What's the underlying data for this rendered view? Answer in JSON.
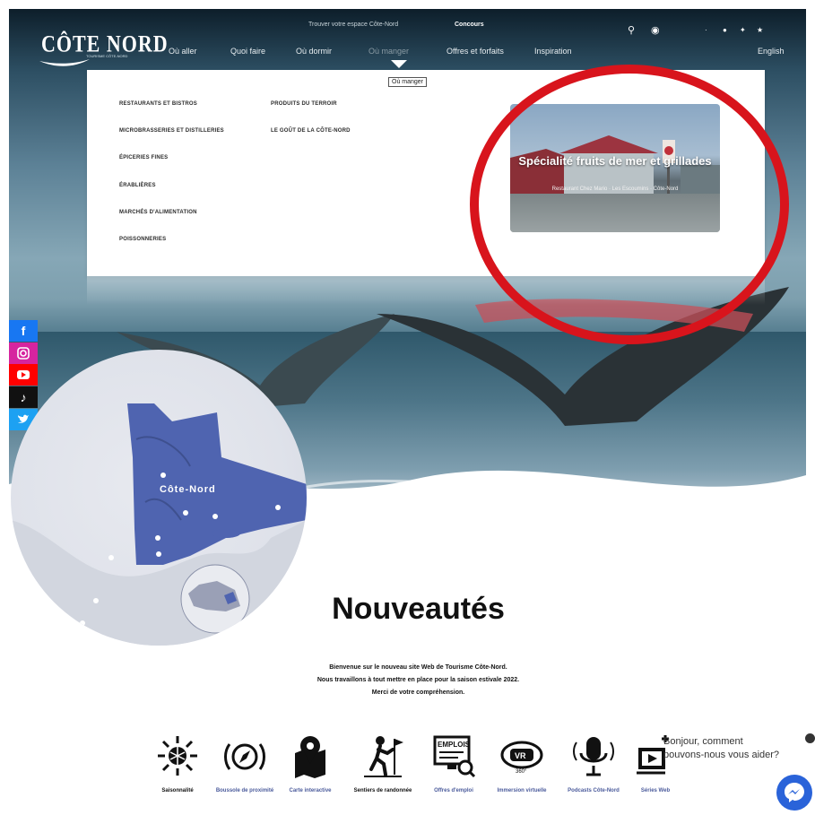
{
  "brand": {
    "logo": "CÔTE NORD",
    "logo_sub": "TOURISME CÔTE-NORD"
  },
  "top_utility": {
    "space_link": "Trouver votre espace Côte-Nord",
    "contest": "Concours"
  },
  "nav": {
    "items": [
      "Où aller",
      "Quoi faire",
      "Où dormir",
      "Où manger",
      "Offres et forfaits",
      "Inspiration"
    ],
    "language": "English",
    "active": "Où manger",
    "tooltip": "Où manger"
  },
  "dropdown": {
    "col1": [
      "RESTAURANTS ET BISTROS",
      "MICROBRASSERIES ET DISTILLERIES",
      "ÉPICERIES FINES",
      "ÉRABLIÈRES",
      "MARCHÉS D'ALIMENTATION",
      "POISSONNERIES"
    ],
    "col2": [
      "PRODUITS DU TERROIR",
      "LE GOÛT DE LA CÔTE-NORD"
    ],
    "promo": {
      "title": "Spécialité fruits de mer et grillades",
      "subtitle": "Restaurant Chez Mario · Les Escoumins · Côte-Nord"
    }
  },
  "social": [
    "facebook-icon",
    "instagram-icon",
    "youtube-icon",
    "tiktok-icon",
    "twitter-icon"
  ],
  "social_colors": [
    "#1877f2",
    "#d6249f",
    "#ff0000",
    "#111111",
    "#1da1f2"
  ],
  "map": {
    "region_label": "Côte-Nord",
    "region_color": "#4f64b0"
  },
  "news": {
    "title": "Nouveautés",
    "lines": [
      "Bienvenue sur le nouveau site Web de Tourisme Côte-Nord.",
      "Nous travaillons à tout mettre en place pour la saison estivale 2022.",
      "Merci de votre compréhension."
    ]
  },
  "icons": [
    {
      "icon": "sun-snowflake-icon",
      "label": "Saisonnalité"
    },
    {
      "icon": "compass-icon",
      "label": "Boussole de proximité"
    },
    {
      "icon": "map-pin-icon",
      "label": "Carte interactive"
    },
    {
      "icon": "hiker-icon",
      "label": "Sentiers de randonnée"
    },
    {
      "icon": "job-board-icon",
      "label": "Offres d'emploi"
    },
    {
      "icon": "vr-headset-icon",
      "label": "Immersion virtuelle"
    },
    {
      "icon": "microphone-icon",
      "label": "Podcasts Côte-Nord"
    },
    {
      "icon": "web-series-icon",
      "label": "Séries Web"
    }
  ],
  "chat": {
    "line1": "Bonjour, comment",
    "line2": "pouvons-nous vous aider?"
  },
  "accent": {
    "annotation_red": "#d8141c",
    "icon_blue": "#4a5a9b"
  }
}
